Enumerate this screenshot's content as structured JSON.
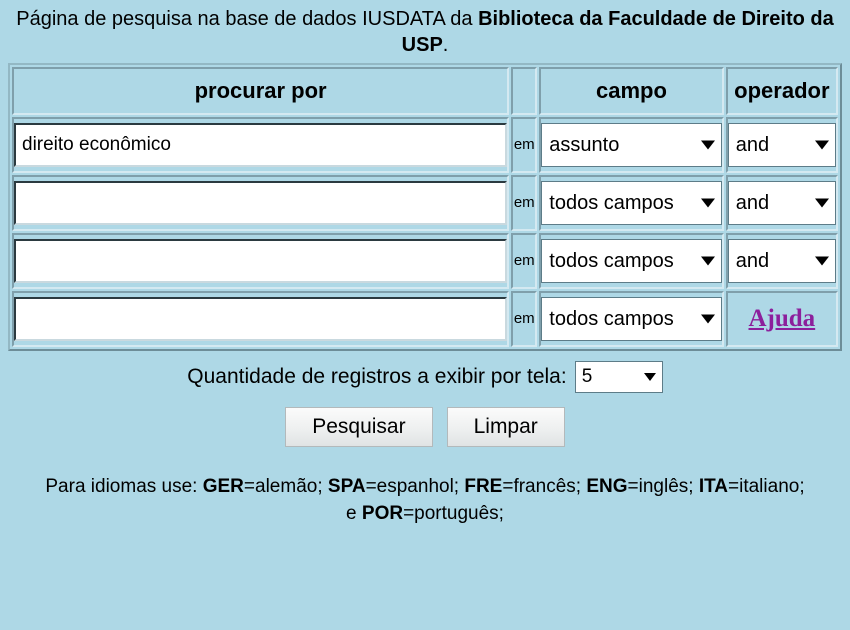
{
  "colors": {
    "background": "#aed8e6",
    "link": "#8c1f9c",
    "text": "#000000",
    "input_background": "#ffffff"
  },
  "header": {
    "text_before_bold": "Página de pesquisa na base de dados IUSDATA da ",
    "bold_text": "Biblioteca da Faculdade de Direito da USP",
    "text_after_bold": "."
  },
  "table": {
    "headers": {
      "term": "procurar por",
      "blank": "",
      "field": "campo",
      "operator": "operador"
    },
    "em_label": "em",
    "rows": [
      {
        "term_value": "direito econômico",
        "term_placeholder": "",
        "em": "em",
        "field_value": "assunto",
        "operator_value": "and",
        "operator_is_link": false
      },
      {
        "term_value": "",
        "term_placeholder": "",
        "em": "em",
        "field_value": "todos campos",
        "operator_value": "and",
        "operator_is_link": false
      },
      {
        "term_value": "",
        "term_placeholder": "",
        "em": "em",
        "field_value": "todos campos",
        "operator_value": "and",
        "operator_is_link": false
      },
      {
        "term_value": "",
        "term_placeholder": "",
        "em": "em",
        "field_value": "todos campos",
        "operator_value": "Ajuda",
        "operator_is_link": true
      }
    ]
  },
  "quantity": {
    "label": "Quantidade de registros a exibir por tela:",
    "value": "5"
  },
  "buttons": {
    "search": "Pesquisar",
    "clear": "Limpar"
  },
  "footer": {
    "line1_intro": "Para idiomas use: ",
    "codes": [
      {
        "code": "GER",
        "lang": "=alemão; "
      },
      {
        "code": "SPA",
        "lang": "=espanhol; "
      },
      {
        "code": "FRE",
        "lang": "=francês; "
      },
      {
        "code": "ENG",
        "lang": "=inglês; "
      },
      {
        "code": "ITA",
        "lang": "=italiano;"
      }
    ],
    "line2_intro": "e ",
    "line2_code": "POR",
    "line2_lang": "=português;"
  },
  "icons": {
    "dropdown_arrow": "chevron-down-icon"
  }
}
